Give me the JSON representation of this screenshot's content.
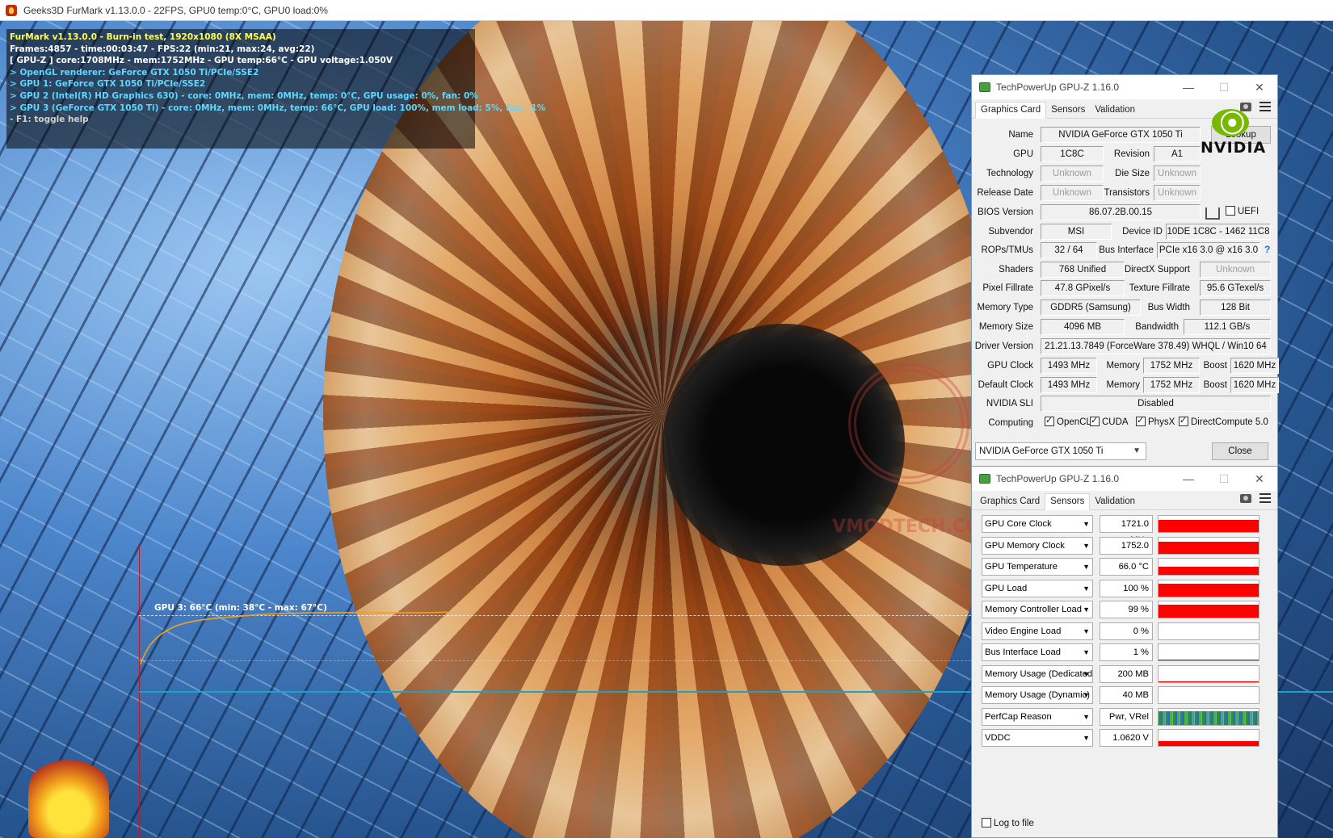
{
  "furmark": {
    "title": "Geeks3D FurMark v1.13.0.0 - 22FPS, GPU0 temp:0°C, GPU0 load:0%",
    "osd": {
      "line1": "FurMark v1.13.0.0 - Burn-in test, 1920x1080 (8X MSAA)",
      "line2": "Frames:4857 - time:00:03:47 - FPS:22 (min:21, max:24, avg:22)",
      "line3": "[ GPU-Z ] core:1708MHz - mem:1752MHz - GPU temp:66°C - GPU voltage:1.050V",
      "line4": "> OpenGL renderer: GeForce GTX 1050 Ti/PCIe/SSE2",
      "line5": "> GPU 1: GeForce GTX 1050 Ti/PCIe/SSE2",
      "line6": "> GPU 2 (Intel(R) HD Graphics 630) - core: 0MHz, mem: 0MHz, temp: 0°C, GPU usage: 0%, fan: 0%",
      "line7": "> GPU 3 (GeForce GTX 1050 Ti) - core: 0MHz, mem: 0MHz, temp: 66°C, GPU load: 100%, mem load: 5%, fan: -1%",
      "line8": "- F1: toggle help"
    },
    "graph_label": "GPU 3: 66°C (min: 38°C - max: 67°C)",
    "watermark": "VMODTECH.COM"
  },
  "gpuz_card": {
    "title": "TechPowerUp GPU-Z 1.16.0",
    "tabs": [
      "Graphics Card",
      "Sensors",
      "Validation"
    ],
    "active_tab": "Graphics Card",
    "labels": {
      "name": "Name",
      "gpu": "GPU",
      "revision": "Revision",
      "technology": "Technology",
      "die_size": "Die Size",
      "release_date": "Release Date",
      "transistors": "Transistors",
      "bios_version": "BIOS Version",
      "uefi": "UEFI",
      "subvendor": "Subvendor",
      "device_id": "Device ID",
      "rops_tmus": "ROPs/TMUs",
      "bus_interface": "Bus Interface",
      "shaders": "Shaders",
      "directx": "DirectX Support",
      "pixel_fillrate": "Pixel Fillrate",
      "texture_fillrate": "Texture Fillrate",
      "memory_type": "Memory Type",
      "bus_width": "Bus Width",
      "memory_size": "Memory Size",
      "bandwidth": "Bandwidth",
      "driver_version": "Driver Version",
      "gpu_clock": "GPU Clock",
      "memory": "Memory",
      "boost": "Boost",
      "default_clock": "Default Clock",
      "nvidia_sli": "NVIDIA SLI",
      "computing": "Computing"
    },
    "values": {
      "name": "NVIDIA GeForce GTX 1050 Ti",
      "gpu": "1C8C",
      "revision": "A1",
      "technology": "Unknown",
      "die_size": "Unknown",
      "release_date": "Unknown",
      "transistors": "Unknown",
      "bios_version": "86.07.2B.00.15",
      "subvendor": "MSI",
      "device_id": "10DE 1C8C - 1462 11C8",
      "rops_tmus": "32 / 64",
      "bus_interface": "PCIe x16 3.0 @ x16 3.0",
      "shaders": "768 Unified",
      "directx": "Unknown",
      "pixel_fillrate": "47.8 GPixel/s",
      "texture_fillrate": "95.6 GTexel/s",
      "memory_type": "GDDR5 (Samsung)",
      "bus_width": "128 Bit",
      "memory_size": "4096 MB",
      "bandwidth": "112.1 GB/s",
      "driver_version": "21.21.13.7849 (ForceWare 378.49) WHQL / Win10 64",
      "gpu_clock": "1493 MHz",
      "gpu_memory": "1752 MHz",
      "gpu_boost": "1620 MHz",
      "default_clock": "1493 MHz",
      "default_memory": "1752 MHz",
      "default_boost": "1620 MHz",
      "nvidia_sli": "Disabled"
    },
    "computing": [
      "OpenCL",
      "CUDA",
      "PhysX",
      "DirectCompute 5.0"
    ],
    "lookup_label": "Lookup",
    "help": "?",
    "vendor_logo_text": "NVIDIA",
    "selected_gpu": "NVIDIA GeForce GTX 1050 Ti",
    "close_label": "Close"
  },
  "gpuz_sensors": {
    "title": "TechPowerUp GPU-Z 1.16.0",
    "tabs": [
      "Graphics Card",
      "Sensors",
      "Validation"
    ],
    "active_tab": "Sensors",
    "sensors": [
      {
        "name": "GPU Core Clock",
        "value": "1721.0 MHz",
        "level": 0.95
      },
      {
        "name": "GPU Memory Clock",
        "value": "1752.0 MHz",
        "level": 0.95
      },
      {
        "name": "GPU Temperature",
        "value": "66.0 °C",
        "level": 0.6
      },
      {
        "name": "GPU Load",
        "value": "100 %",
        "level": 1.0
      },
      {
        "name": "Memory Controller Load",
        "value": "99 %",
        "level": 0.99
      },
      {
        "name": "Video Engine Load",
        "value": "0 %",
        "level": 0
      },
      {
        "name": "Bus Interface Load",
        "value": "1 %",
        "level": 0.01
      },
      {
        "name": "Memory Usage (Dedicated)",
        "value": "200 MB",
        "level": 0.05
      },
      {
        "name": "Memory Usage (Dynamic)",
        "value": "40 MB",
        "level": 0
      },
      {
        "name": "PerfCap Reason",
        "value": "Pwr, VRel",
        "level": 1.0
      },
      {
        "name": "VDDC",
        "value": "1.0620 V",
        "level": 0.4
      }
    ],
    "log_to_file": "Log to file"
  }
}
